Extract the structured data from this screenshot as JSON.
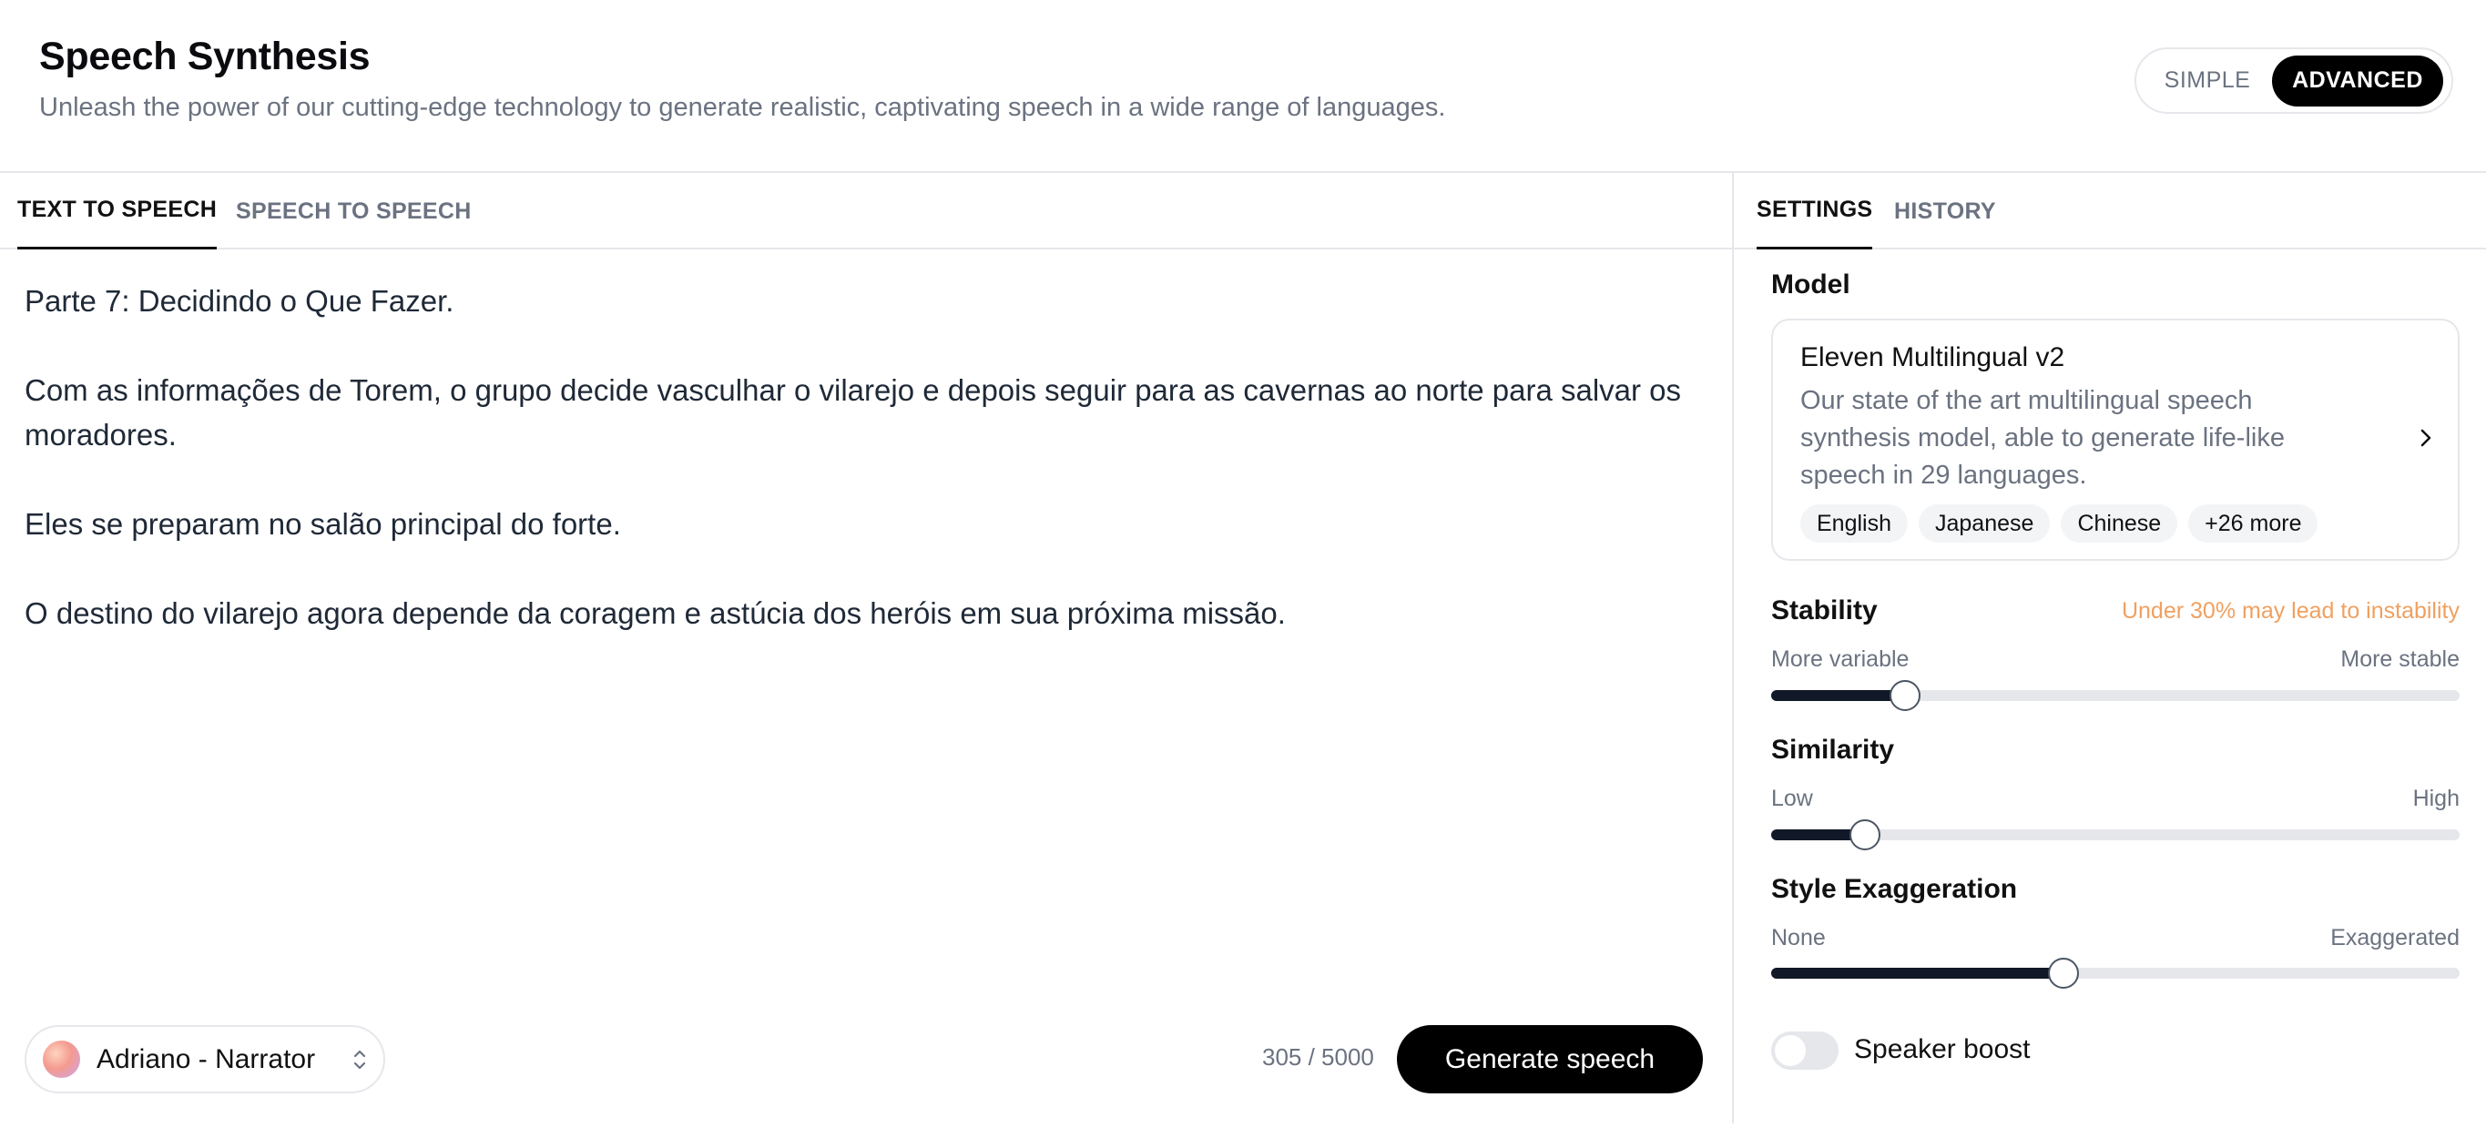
{
  "header": {
    "title": "Speech Synthesis",
    "subtitle": "Unleash the power of our cutting-edge technology to generate realistic, captivating speech in a wide range of languages.",
    "mode": {
      "simple": "SIMPLE",
      "advanced": "ADVANCED",
      "selected": "ADVANCED"
    }
  },
  "left_tabs": [
    {
      "label": "TEXT TO SPEECH",
      "active": true
    },
    {
      "label": "SPEECH TO SPEECH",
      "active": false
    }
  ],
  "editor": {
    "paragraphs": [
      "Parte 7: Decidindo o Que Fazer.",
      "Com as informações de Torem, o grupo decide vasculhar o vilarejo e depois seguir para as cavernas ao norte para salvar os moradores.",
      "Eles se preparam no salão principal do forte.",
      "O destino do vilarejo agora depende da coragem e astúcia dos heróis em sua próxima missão."
    ]
  },
  "footer": {
    "voice": "Adriano - Narrator",
    "char_count": "305 / 5000",
    "generate_label": "Generate speech"
  },
  "right_tabs": [
    {
      "label": "SETTINGS",
      "active": true
    },
    {
      "label": "HISTORY",
      "active": false
    }
  ],
  "settings": {
    "model_label": "Model",
    "model": {
      "name": "Eleven Multilingual v2",
      "description": "Our state of the art multilingual speech synthesis model, able to generate life-like speech in 29 languages.",
      "languages": [
        "English",
        "Japanese",
        "Chinese",
        "+26 more"
      ]
    },
    "stability": {
      "label": "Stability",
      "warning": "Under 30% may lead to instability",
      "min_label": "More variable",
      "max_label": "More stable",
      "value": 0.195
    },
    "similarity": {
      "label": "Similarity",
      "min_label": "Low",
      "max_label": "High",
      "value": 0.136
    },
    "style": {
      "label": "Style Exaggeration",
      "min_label": "None",
      "max_label": "Exaggerated",
      "value": 0.424
    },
    "speaker_boost": {
      "label": "Speaker boost",
      "enabled": false
    }
  },
  "icons": {
    "voice_picker": "chevron-up-down-icon",
    "model_card": "chevron-right-icon"
  },
  "colors": {
    "accent": "#000000",
    "warning": "#f0a060",
    "muted": "#6b7280"
  }
}
